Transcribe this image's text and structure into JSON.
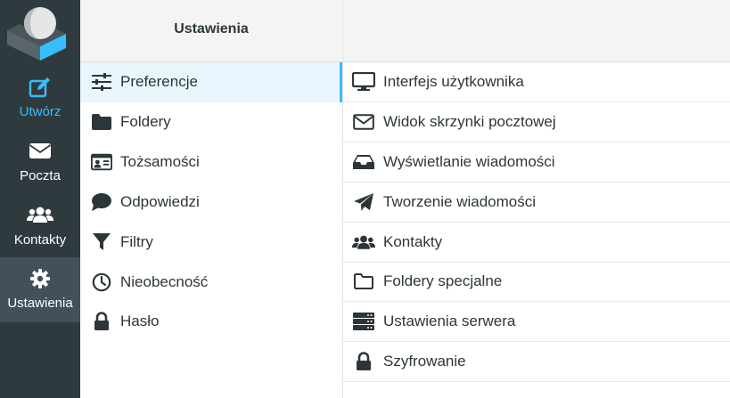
{
  "colors": {
    "rail_bg": "#2f3a3f",
    "accent": "#37beff",
    "selected_rail": "#41505a",
    "text": "#2c363a"
  },
  "logo": {
    "icon": "roundcube-logo"
  },
  "nav": [
    {
      "key": "compose",
      "label": "Utwórz",
      "icon": "compose-icon"
    },
    {
      "key": "mail",
      "label": "Poczta",
      "icon": "envelope-icon"
    },
    {
      "key": "contacts",
      "label": "Kontakty",
      "icon": "users-icon"
    },
    {
      "key": "settings",
      "label": "Ustawienia",
      "icon": "gear-icon",
      "selected": true
    }
  ],
  "sections": {
    "title": "Ustawienia",
    "items": [
      {
        "label": "Preferencje",
        "icon": "sliders-icon",
        "active": true
      },
      {
        "label": "Foldery",
        "icon": "folder-icon"
      },
      {
        "label": "Tożsamości",
        "icon": "id-card-icon"
      },
      {
        "label": "Odpowiedzi",
        "icon": "comment-icon"
      },
      {
        "label": "Filtry",
        "icon": "filter-icon"
      },
      {
        "label": "Nieobecność",
        "icon": "clock-icon"
      },
      {
        "label": "Hasło",
        "icon": "lock-icon"
      }
    ]
  },
  "preferences": {
    "items": [
      {
        "label": "Interfejs użytkownika",
        "icon": "monitor-icon"
      },
      {
        "label": "Widok skrzynki pocztowej",
        "icon": "envelope-outline-icon"
      },
      {
        "label": "Wyświetlanie wiadomości",
        "icon": "inbox-icon"
      },
      {
        "label": "Tworzenie wiadomości",
        "icon": "paper-plane-icon"
      },
      {
        "label": "Kontakty",
        "icon": "users-icon"
      },
      {
        "label": "Foldery specjalne",
        "icon": "folder-outline-icon"
      },
      {
        "label": "Ustawienia serwera",
        "icon": "server-icon"
      },
      {
        "label": "Szyfrowanie",
        "icon": "lock-icon"
      }
    ]
  }
}
